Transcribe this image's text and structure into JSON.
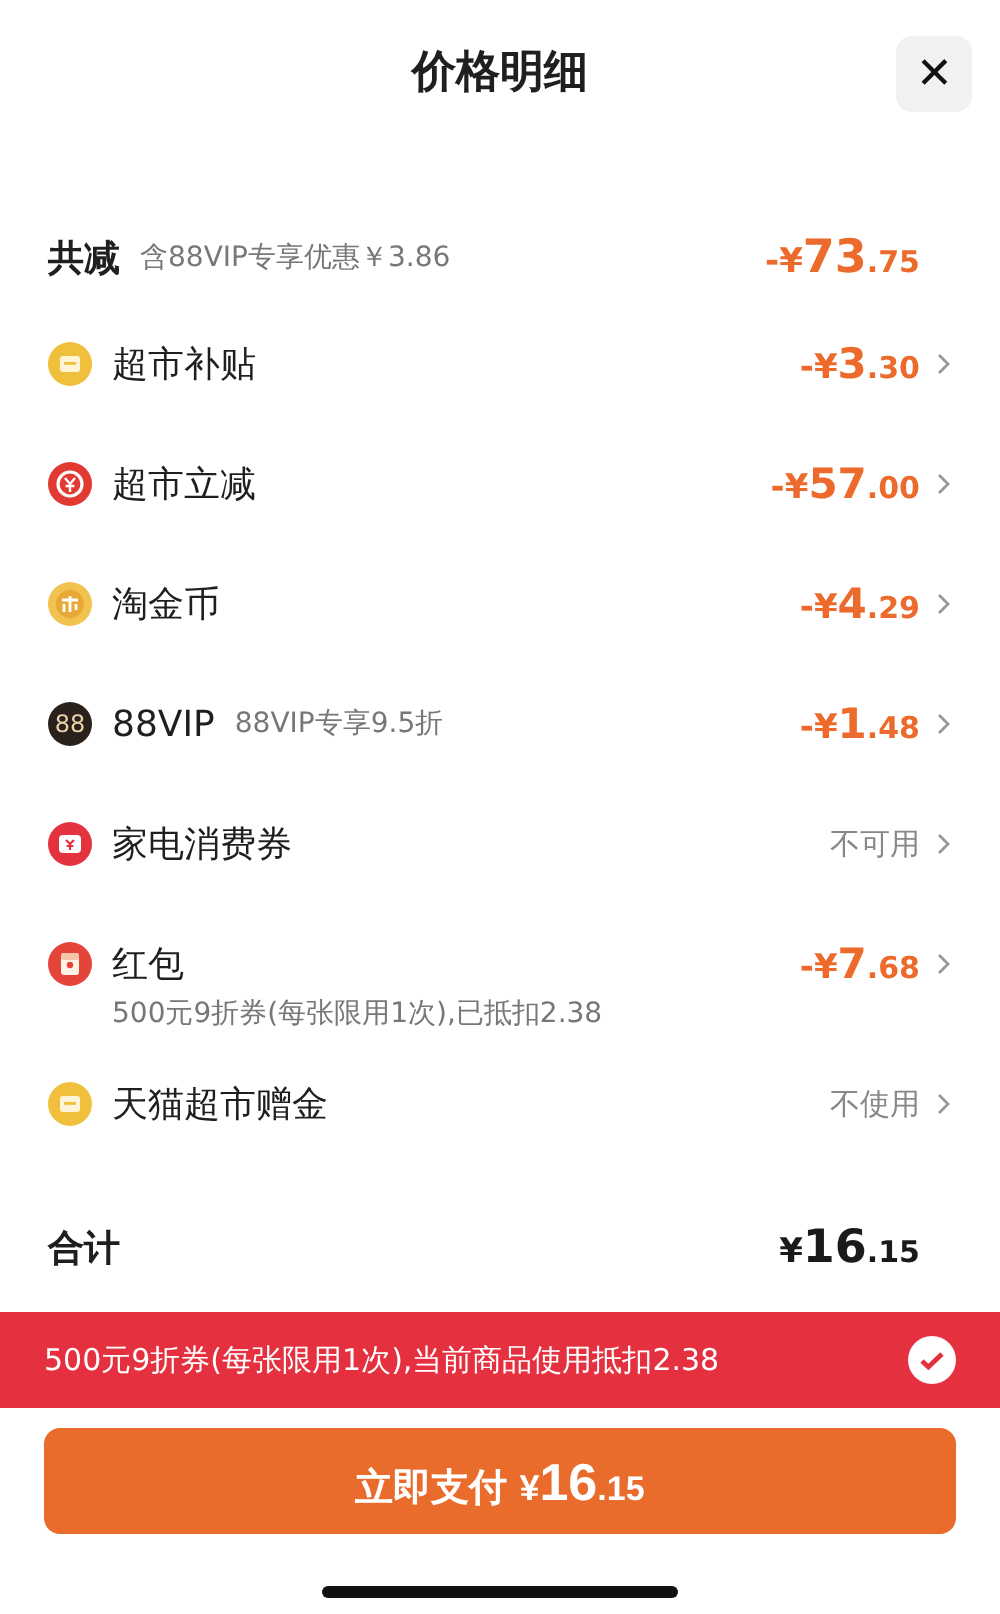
{
  "header": {
    "title": "价格明细",
    "close": "✕"
  },
  "total_discount": {
    "label": "共减",
    "note": "含88VIP专享优惠￥3.86",
    "amount": {
      "sign": "-¥",
      "int": "73",
      "dec": ".75"
    }
  },
  "rows": [
    {
      "kind": "card",
      "label": "超市补贴",
      "value": {
        "kind": "amount",
        "sign": "-¥",
        "int": "3",
        "dec": ".30"
      }
    },
    {
      "kind": "yuan",
      "label": "超市立减",
      "value": {
        "kind": "amount",
        "sign": "-¥",
        "int": "57",
        "dec": ".00"
      }
    },
    {
      "kind": "coin",
      "label": "淘金币",
      "value": {
        "kind": "amount",
        "sign": "-¥",
        "int": "4",
        "dec": ".29"
      }
    },
    {
      "kind": "vip",
      "icon_text": "88",
      "label": "88VIP",
      "note": "88VIP专享9.5折",
      "value": {
        "kind": "amount",
        "sign": "-¥",
        "int": "1",
        "dec": ".48"
      }
    },
    {
      "kind": "ticket",
      "label": "家电消费券",
      "value": {
        "kind": "text",
        "text": "不可用"
      }
    },
    {
      "kind": "redpacket",
      "label": "红包",
      "sub": "500元9折券(每张限用1次),已抵扣2.38",
      "value": {
        "kind": "amount",
        "sign": "-¥",
        "int": "7",
        "dec": ".68"
      }
    },
    {
      "kind": "card",
      "label": "天猫超市赠金",
      "value": {
        "kind": "text",
        "text": "不使用"
      }
    }
  ],
  "total": {
    "label": "合计",
    "amount": {
      "sign": "¥",
      "int": "16",
      "dec": ".15"
    }
  },
  "banner": {
    "text": "500元9折券(每张限用1次),当前商品使用抵扣2.38",
    "checked": true
  },
  "pay_button": {
    "label": "立即支付",
    "amount": {
      "sign": "¥",
      "int": "16",
      "dec": ".15"
    }
  }
}
